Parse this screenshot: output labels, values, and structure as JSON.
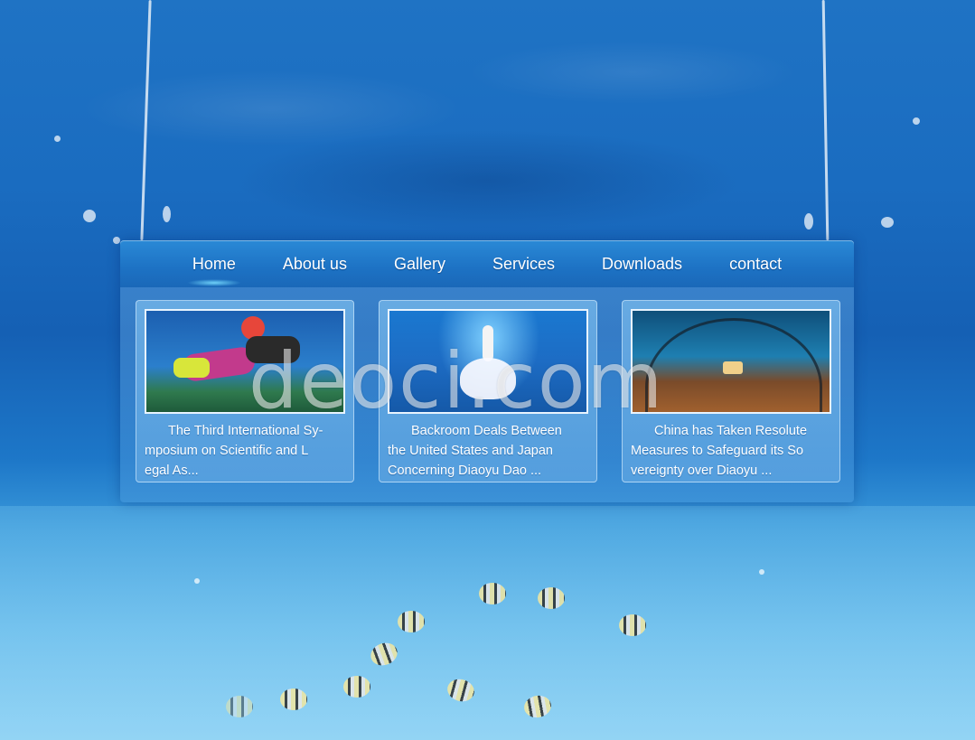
{
  "nav": {
    "items": [
      "Home",
      "About us",
      "Gallery",
      "Services",
      "Downloads",
      "contact"
    ],
    "active_index": 0
  },
  "cards": [
    {
      "image": "diver-thumbnail",
      "caption": "The Third International Sy-\nmposium on Scientific and L\negal As..."
    },
    {
      "image": "underwater-dancer-thumbnail",
      "caption": "Backroom Deals Between\nthe United States and Japan\nConcerning Diaoyu Dao ..."
    },
    {
      "image": "aquarium-tunnel-thumbnail",
      "caption": "China has Taken Resolute\nMeasures to Safeguard its So\nvereignty over Diaoyu ..."
    }
  ],
  "watermark": "deoci.com",
  "colors": {
    "nav_bg": "#1d72c4",
    "ocean": "#1560b4",
    "sand": "#7cc7ef"
  }
}
